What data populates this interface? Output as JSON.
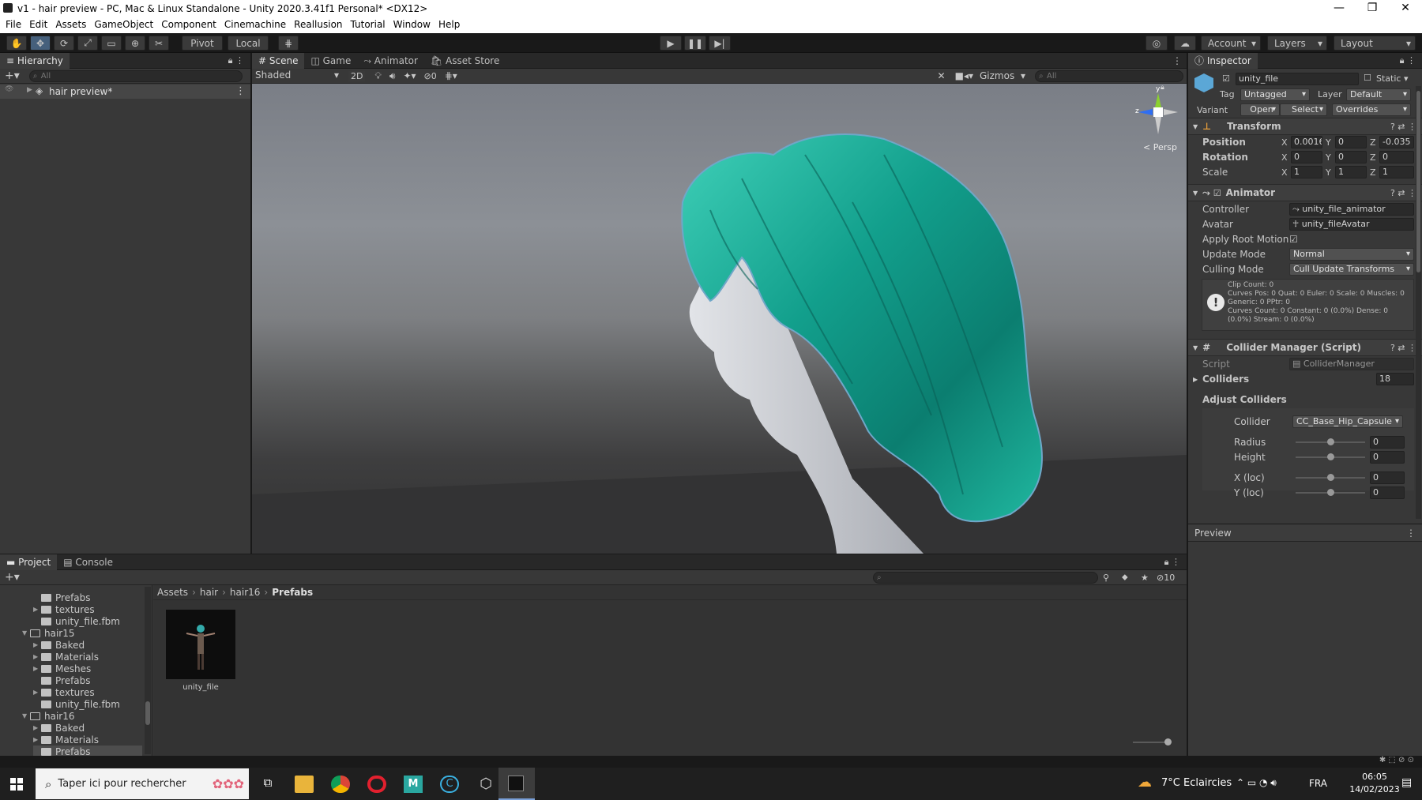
{
  "window": {
    "title": "v1 - hair preview - PC, Mac & Linux Standalone - Unity 2020.3.41f1 Personal* <DX12>",
    "controls": [
      "—",
      "❐",
      "✕"
    ]
  },
  "menu": [
    "File",
    "Edit",
    "Assets",
    "GameObject",
    "Component",
    "Cinemachine",
    "Reallusion",
    "Tutorial",
    "Window",
    "Help"
  ],
  "toolbar": {
    "pivot": "Pivot",
    "local": "Local",
    "account": "Account",
    "layers": "Layers",
    "layout": "Layout"
  },
  "hierarchy": {
    "tab": "Hierarchy",
    "search_placeholder": "All",
    "scene_item": "hair preview*"
  },
  "scene_tabs": [
    "Scene",
    "Game",
    "Animator",
    "Asset Store"
  ],
  "scene_toolbar": {
    "shading": "Shaded",
    "mode_2d": "2D",
    "hidden_count": "0",
    "gizmos": "Gizmos",
    "search_placeholder": "All",
    "persp": "< Persp",
    "axis_y": "y",
    "axis_z": "z"
  },
  "inspector": {
    "tab": "Inspector",
    "object_name": "unity_file",
    "static": "Static",
    "tag_label": "Tag",
    "tag_value": "Untagged",
    "layer_label": "Layer",
    "layer_value": "Default",
    "variant_label": "Variant",
    "open": "Open",
    "select": "Select",
    "overrides": "Overrides",
    "transform": {
      "title": "Transform",
      "position_label": "Position",
      "rotation_label": "Rotation",
      "scale_label": "Scale",
      "position": [
        "0.0016",
        "0",
        "-0.035"
      ],
      "rotation": [
        "0",
        "0",
        "0"
      ],
      "scale": [
        "1",
        "1",
        "1"
      ]
    },
    "animator": {
      "title": "Animator",
      "controller_label": "Controller",
      "controller": "unity_file_animator",
      "avatar_label": "Avatar",
      "avatar": "unity_fileAvatar",
      "apply_root_motion": "Apply Root Motion",
      "update_mode_label": "Update Mode",
      "update_mode": "Normal",
      "culling_mode_label": "Culling Mode",
      "culling_mode": "Cull Update Transforms",
      "info": [
        "Clip Count: 0",
        "Curves Pos: 0 Quat: 0 Euler: 0 Scale: 0 Muscles: 0",
        "Generic: 0 PPtr: 0",
        "Curves Count: 0 Constant: 0 (0.0%) Dense: 0",
        "(0.0%) Stream: 0 (0.0%)"
      ]
    },
    "collider_manager": {
      "title": "Collider Manager (Script)",
      "script_label": "Script",
      "script": "ColliderManager",
      "colliders_label": "Colliders",
      "colliders_count": "18",
      "adjust": "Adjust Colliders",
      "collider_label": "Collider",
      "collider_value": "CC_Base_Hip_Capsule",
      "radius_label": "Radius",
      "radius": "0",
      "height_label": "Height",
      "height": "0",
      "xloc_label": "X (loc)",
      "xloc": "0",
      "yloc_label": "Y (loc)",
      "yloc": "0"
    }
  },
  "preview": {
    "title": "Preview"
  },
  "project": {
    "tabs": [
      "Project",
      "Console"
    ],
    "hidden_count": "10",
    "tree": [
      {
        "label": "Prefabs",
        "indent": 3,
        "arrow": false
      },
      {
        "label": "textures",
        "indent": 3,
        "arrow": true
      },
      {
        "label": "unity_file.fbm",
        "indent": 3,
        "arrow": false
      },
      {
        "label": "hair15",
        "indent": 2,
        "arrow": true,
        "open": true
      },
      {
        "label": "Baked",
        "indent": 3,
        "arrow": true
      },
      {
        "label": "Materials",
        "indent": 3,
        "arrow": true
      },
      {
        "label": "Meshes",
        "indent": 3,
        "arrow": true
      },
      {
        "label": "Prefabs",
        "indent": 3,
        "arrow": false
      },
      {
        "label": "textures",
        "indent": 3,
        "arrow": true
      },
      {
        "label": "unity_file.fbm",
        "indent": 3,
        "arrow": false
      },
      {
        "label": "hair16",
        "indent": 2,
        "arrow": true,
        "open": true
      },
      {
        "label": "Baked",
        "indent": 3,
        "arrow": true
      },
      {
        "label": "Materials",
        "indent": 3,
        "arrow": true
      },
      {
        "label": "Prefabs",
        "indent": 3,
        "arrow": false,
        "selected": true
      }
    ],
    "breadcrumb": [
      "Assets",
      "hair",
      "hair16",
      "Prefabs"
    ],
    "asset_name": "unity_file"
  },
  "taskbar": {
    "search_placeholder": "Taper ici pour rechercher",
    "weather": "7°C  Eclaircies",
    "lang": "FRA",
    "time": "06:05",
    "date": "14/02/2023"
  }
}
